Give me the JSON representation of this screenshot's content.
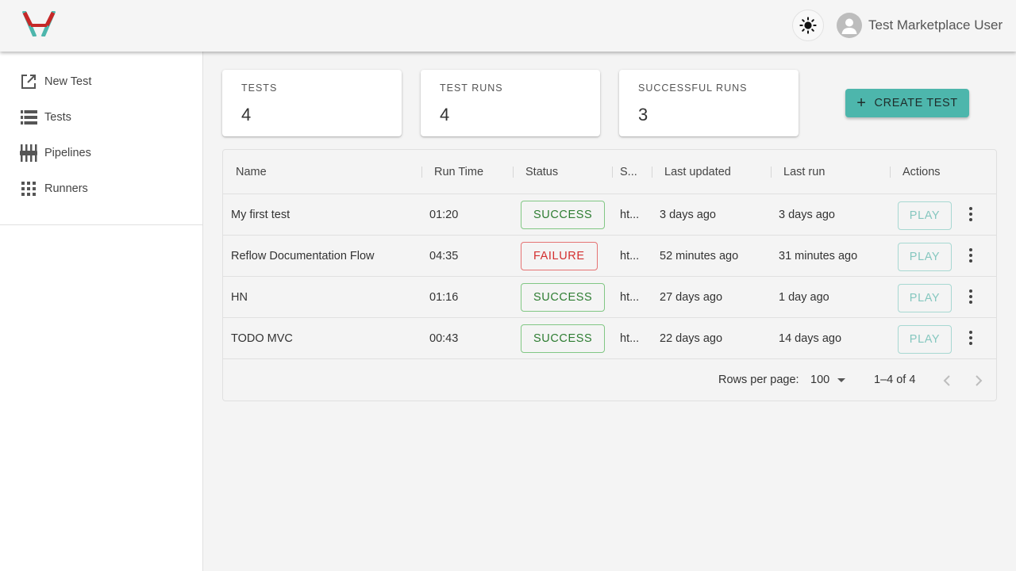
{
  "header": {
    "logo_icon": "app-logo",
    "theme_icon": "sun-icon",
    "user_name": "Test Marketplace User"
  },
  "sidebar": {
    "items": [
      {
        "label": "New Test",
        "icon": "open-in-new-icon"
      },
      {
        "label": "Tests",
        "icon": "list-icon"
      },
      {
        "label": "Pipelines",
        "icon": "pipelines-icon"
      },
      {
        "label": "Runners",
        "icon": "grid-icon"
      }
    ]
  },
  "stats": [
    {
      "label": "TESTS",
      "value": "4"
    },
    {
      "label": "TEST RUNS",
      "value": "4"
    },
    {
      "label": "SUCCESSFUL RUNS",
      "value": "3"
    }
  ],
  "create_button": {
    "label": "CREATE TEST",
    "icon": "plus-icon"
  },
  "table": {
    "columns": [
      "Name",
      "Run Time",
      "Status",
      "S...",
      "Last updated",
      "Last run",
      "Actions"
    ],
    "rows": [
      {
        "name": "My first test",
        "run_time": "01:20",
        "status": "SUCCESS",
        "url": "ht...",
        "last_updated": "3 days ago",
        "last_run": "3 days ago",
        "action": "PLAY"
      },
      {
        "name": "Reflow Documentation Flow",
        "run_time": "04:35",
        "status": "FAILURE",
        "url": "ht...",
        "last_updated": "52 minutes ago",
        "last_run": "31 minutes ago",
        "action": "PLAY"
      },
      {
        "name": "HN",
        "run_time": "01:16",
        "status": "SUCCESS",
        "url": "ht...",
        "last_updated": "27 days ago",
        "last_run": "1 day ago",
        "action": "PLAY"
      },
      {
        "name": "TODO MVC",
        "run_time": "00:43",
        "status": "SUCCESS",
        "url": "ht...",
        "last_updated": "22 days ago",
        "last_run": "14 days ago",
        "action": "PLAY"
      }
    ]
  },
  "pagination": {
    "rows_per_page_label": "Rows per page:",
    "rows_per_page_value": "100",
    "range": "1–4 of 4"
  },
  "colors": {
    "accent": "#4db6ac",
    "success": "#2e7d32",
    "success_border": "#81c784",
    "failure": "#d32f2f",
    "failure_border": "#e57373",
    "logo_teal": "#4db6ac",
    "logo_red": "#c62828"
  }
}
